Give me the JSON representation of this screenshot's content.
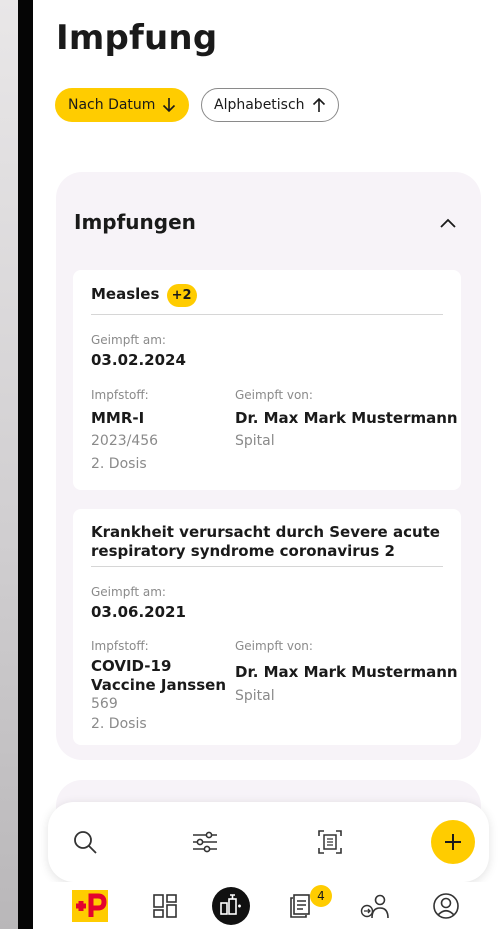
{
  "page": {
    "title": "Impfung"
  },
  "sort": {
    "by_date": "Nach Datum",
    "alphabetical": "Alphabetisch"
  },
  "section": {
    "title": "Impfungen"
  },
  "vaccinations": [
    {
      "disease": "Measles",
      "more_count": "+2",
      "date_label": "Geimpft am:",
      "date": "03.02.2024",
      "vaccine_label": "Impfstoff:",
      "vaccine": "MMR-I",
      "lot": "2023/456",
      "dose": "2. Dosis",
      "by_label": "Geimpft von:",
      "by": "Dr. Max Mark Mustermann",
      "place": "Spital"
    },
    {
      "disease": "Krankheit verursacht durch Severe acute respiratory syndrome coronavirus 2",
      "date_label": "Geimpft am:",
      "date": "03.06.2021",
      "vaccine_label": "Impfstoff:",
      "vaccine": "COVID-19 Vaccine Janssen",
      "lot": "569",
      "dose": "2. Dosis",
      "by_label": "Geimpft von:",
      "by": "Dr. Max Mark Mustermann",
      "place": "Spital"
    }
  ],
  "toolbar": {
    "icons": [
      "search-icon",
      "filter-sliders-icon",
      "scan-document-icon",
      "plus-icon"
    ]
  },
  "tabbar": {
    "icons": [
      "post-logo-icon",
      "dashboard-icon",
      "vaccination-icon",
      "documents-icon",
      "person-share-icon",
      "profile-icon"
    ],
    "documents_badge": "4"
  },
  "colors": {
    "accent": "#ffcc00",
    "post_red": "#e4032e",
    "card_bg": "#f7f3f8"
  }
}
